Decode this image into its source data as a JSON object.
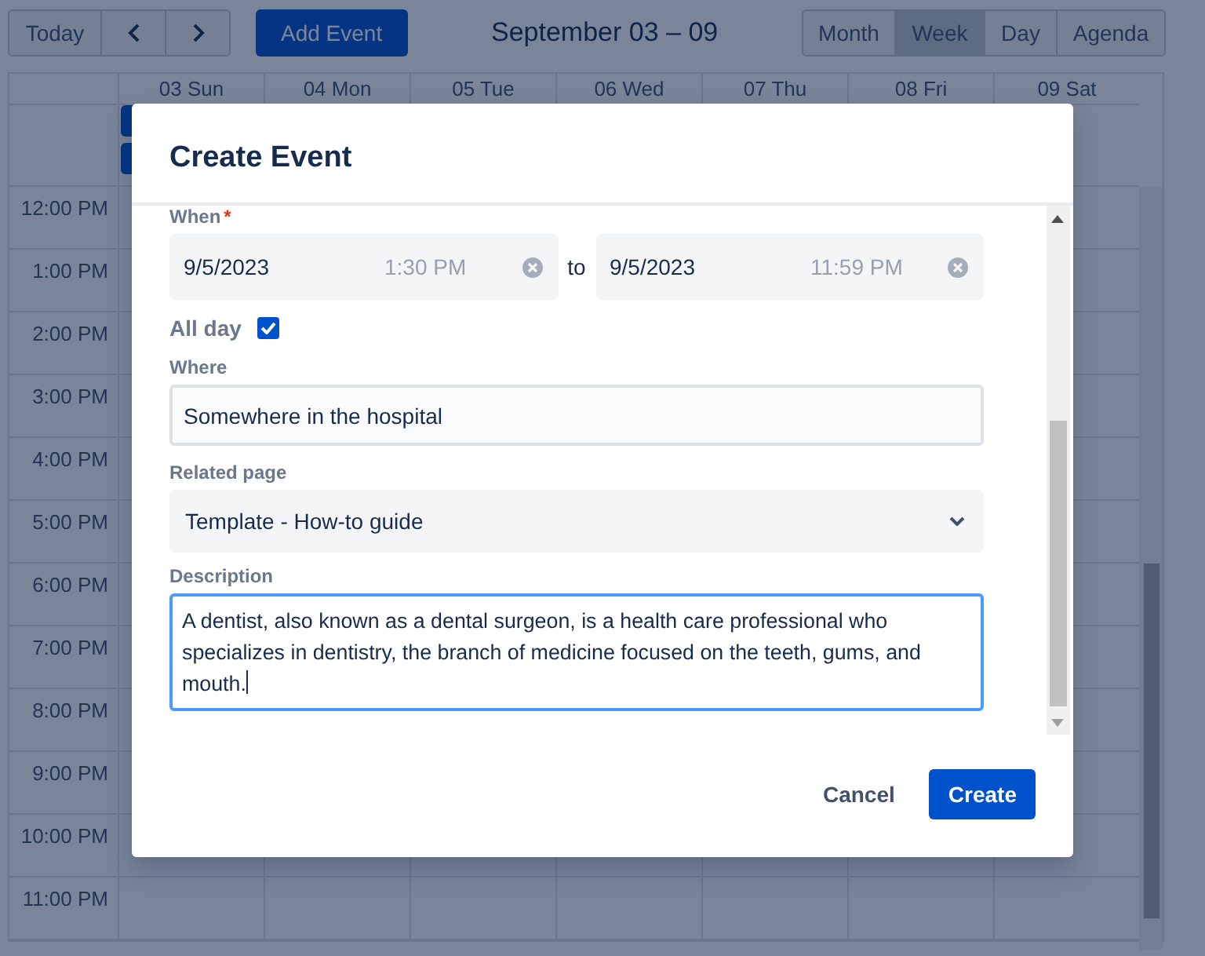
{
  "toolbar": {
    "today": "Today",
    "add_event": "Add Event",
    "title": "September 03 – 09",
    "views": [
      {
        "label": "Month",
        "selected": false
      },
      {
        "label": "Week",
        "selected": true
      },
      {
        "label": "Day",
        "selected": false
      },
      {
        "label": "Agenda",
        "selected": false
      }
    ]
  },
  "calendar": {
    "days": [
      "03 Sun",
      "04 Mon",
      "05 Tue",
      "06 Wed",
      "07 Thu",
      "08 Fri",
      "09 Sat"
    ],
    "times": [
      "12:00 PM",
      "1:00 PM",
      "2:00 PM",
      "3:00 PM",
      "4:00 PM",
      "5:00 PM",
      "6:00 PM",
      "7:00 PM",
      "8:00 PM",
      "9:00 PM",
      "10:00 PM",
      "11:00 PM"
    ]
  },
  "dialog": {
    "title": "Create Event",
    "when": {
      "label": "When",
      "required_mark": "*",
      "separator": "to",
      "start": {
        "date": "9/5/2023",
        "time": "1:30 PM",
        "time_disabled": true
      },
      "end": {
        "date": "9/5/2023",
        "time": "11:59 PM",
        "time_disabled": true
      }
    },
    "all_day": {
      "label": "All day",
      "checked": true
    },
    "where": {
      "label": "Where",
      "value": "Somewhere in the hospital"
    },
    "related_page": {
      "label": "Related page",
      "value": "Template - How-to guide"
    },
    "description": {
      "label": "Description",
      "value": "A dentist, also known as a dental surgeon, is a health care professional who specializes in dentistry, the branch of medicine focused on the teeth, gums, and mouth.",
      "focused": true
    },
    "buttons": [
      {
        "label": "Cancel",
        "kind": "subtle"
      },
      {
        "label": "Create",
        "kind": "primary"
      }
    ]
  }
}
